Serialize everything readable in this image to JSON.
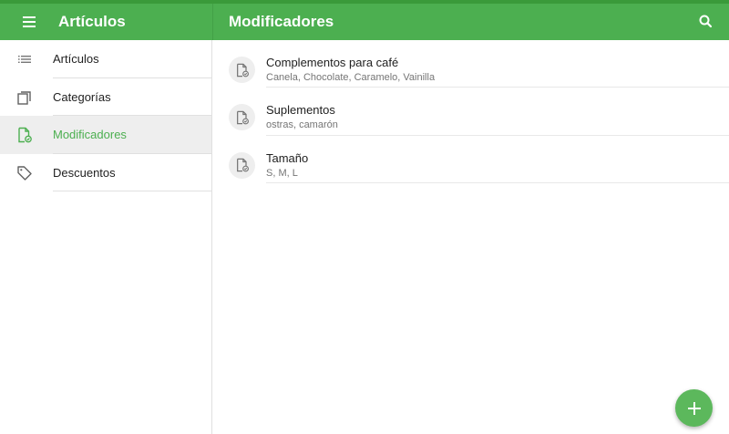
{
  "colors": {
    "brand_green": "#4caf50",
    "top_strip": "#3a9a3a",
    "fab_green": "#5cb85c",
    "active_background": "#eeeeee"
  },
  "sidebar": {
    "title": "Artículos",
    "menu_icon": "hamburger-icon",
    "items": [
      {
        "label": "Artículos",
        "icon": "list-icon",
        "active": false
      },
      {
        "label": "Categorías",
        "icon": "copy-stack-icon",
        "active": false
      },
      {
        "label": "Modificadores",
        "icon": "document-check-icon",
        "active": true
      },
      {
        "label": "Descuentos",
        "icon": "tag-icon",
        "active": false
      }
    ]
  },
  "main": {
    "title": "Modificadores",
    "search_icon": "search-icon",
    "modifiers": [
      {
        "name": "Complementos para café",
        "options": "Canela, Chocolate, Caramelo, Vainilla",
        "icon": "document-check-icon"
      },
      {
        "name": "Suplementos",
        "options": "ostras, camarón",
        "icon": "document-check-icon"
      },
      {
        "name": "Tamaño",
        "options": "S, M, L",
        "icon": "document-check-icon"
      }
    ]
  },
  "fab": {
    "icon": "plus-icon"
  }
}
